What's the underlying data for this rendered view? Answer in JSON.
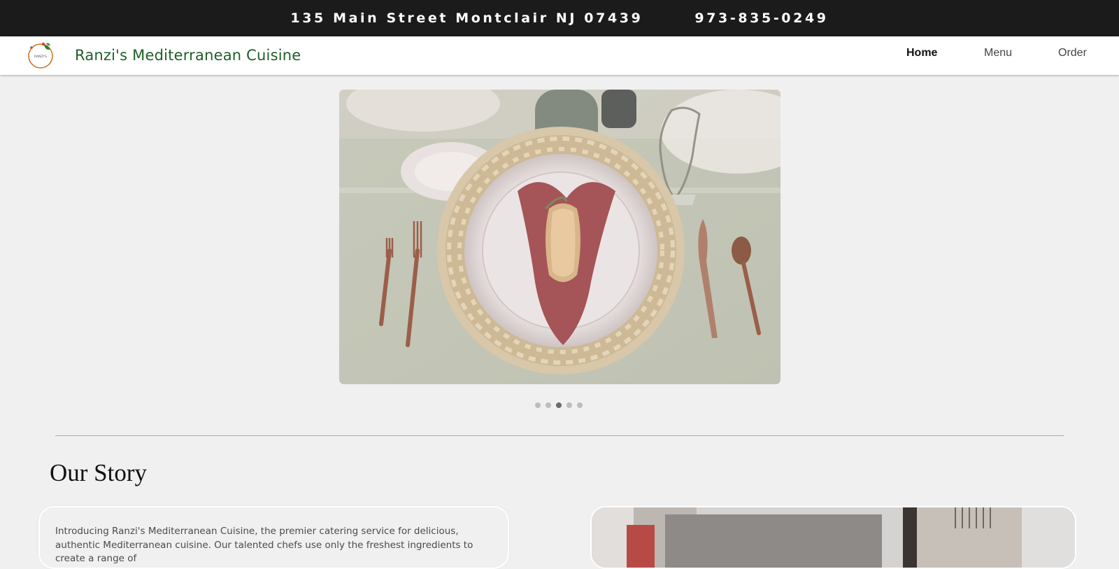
{
  "topbar": {
    "address": "135 Main Street Montclair NJ 07439",
    "phone": "973-835-0249"
  },
  "brand": {
    "logo_text": "RANZI'S",
    "name": "Ranzi's Mediterranean Cuisine"
  },
  "nav": {
    "items": [
      {
        "label": "Home",
        "active": true
      },
      {
        "label": "Menu",
        "active": false
      },
      {
        "label": "Order",
        "active": false
      }
    ]
  },
  "carousel": {
    "slide_count": 5,
    "active_index": 3
  },
  "story": {
    "title": "Our Story",
    "text": "Introducing Ranzi's Mediterranean Cuisine, the premier catering service for delicious, authentic Mediterranean cuisine. Our talented chefs use only the freshest ingredients to create a range of"
  },
  "colors": {
    "brand_green": "#1f5f2a",
    "topbar_bg": "#1b1b1b",
    "page_bg": "#f0f0f0"
  }
}
